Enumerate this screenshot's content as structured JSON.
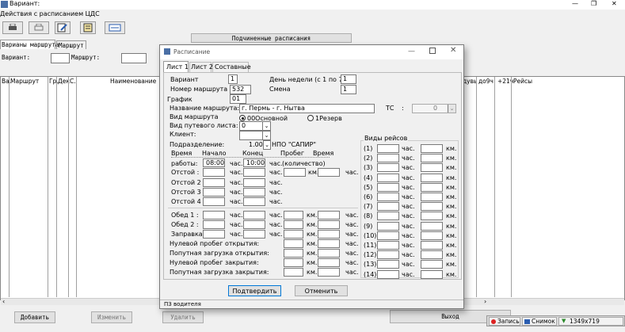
{
  "window": {
    "title": "Вариант:",
    "controls": {
      "min": "—",
      "max": "❐",
      "close": "✕"
    }
  },
  "menu": {
    "text": "Действия с расписанием ЦДС"
  },
  "toolbar": {
    "icons": [
      "printer-icon",
      "printer-outline-icon",
      "document-edit-icon",
      "notes-icon",
      "panel-icon"
    ]
  },
  "main": {
    "tabs": [
      "Варианы маршрута",
      "Маршрут"
    ],
    "subordinate_label": "Подчиненные расписания",
    "variant_label": "Вариант:",
    "route_label": "Маршрут:",
    "table_headers": [
      "Ва.",
      "Маршрут",
      "Гр.",
      "Дек",
      "С.",
      "Наименование"
    ],
    "table_headers_right": [
      "дувь",
      "до9ч",
      "+21ч",
      "Рейсы"
    ],
    "buttons": {
      "add": "Добавить",
      "edit": "Изменить",
      "delete": "Удалить",
      "exit": "Выход"
    }
  },
  "taskbar": {
    "record": "Запись",
    "snapshot": "Снимок",
    "resolution": "1349x719"
  },
  "dialog": {
    "title": "Расписание",
    "tabs": [
      "Лист 1",
      "Лист 2",
      "Составные"
    ],
    "variant_label": "Вариант",
    "variant": "1",
    "weekday_label": "День недели (с 1 по 7)",
    "weekday": "1",
    "route_label": "Номер маршрута",
    "route": "532",
    "shift_label": "Смена",
    "shift": "1",
    "schedule_label": "График",
    "schedule": "01",
    "route_name_label": "Название маршрута:",
    "route_name": "г. Пермь - г. Нытва",
    "ts_label": "ТС",
    "ts_colon": ":",
    "ts_value": "0",
    "route_type_label": "Вид маршрута",
    "radio_main": "00Основной",
    "radio_reserve": "1Резерв",
    "waybill_label": "Вид путевого листа:",
    "waybill": "0",
    "client_label": "Клиент:",
    "client": "",
    "dept_label": "Подразделение:",
    "dept": "1.00",
    "dept_name": "НПО \"САПИР\"",
    "times": {
      "time_label": "Время",
      "start_label": "Начало",
      "end_label": "Конец",
      "mileage_label": "Пробег",
      "time2_label": "Время",
      "work_label": "работы:",
      "quantity_label": "(количество)",
      "start": "08:00",
      "end": "10:00",
      "hrs": "час.",
      "km": "км.",
      "stops": [
        "Отстой :",
        "Отстой 2",
        "Отстой 3",
        "Отстой 4"
      ],
      "lunch": [
        "Обед 1 :",
        "Обед 2 :",
        "Заправка:"
      ],
      "zero_open": "Нулевой пробег   открытия:",
      "pass_open": "Попутная загрузка открытия:",
      "zero_close": "Нулевой пробег   закрытия:",
      "pass_close": "Попутная загрузка закрытия:"
    },
    "trips_title": "Виды рейсов",
    "trips": [
      "(1)",
      "(2)",
      "(3)",
      "(4)",
      "(5)",
      "(6)",
      "(7)",
      "(8)",
      "(9)",
      "(10)",
      "(11)",
      "(12)",
      "(13)",
      "(14)"
    ],
    "confirm": "Подтвердить",
    "cancel": "Отменить",
    "status": "ПЗ водителя"
  }
}
